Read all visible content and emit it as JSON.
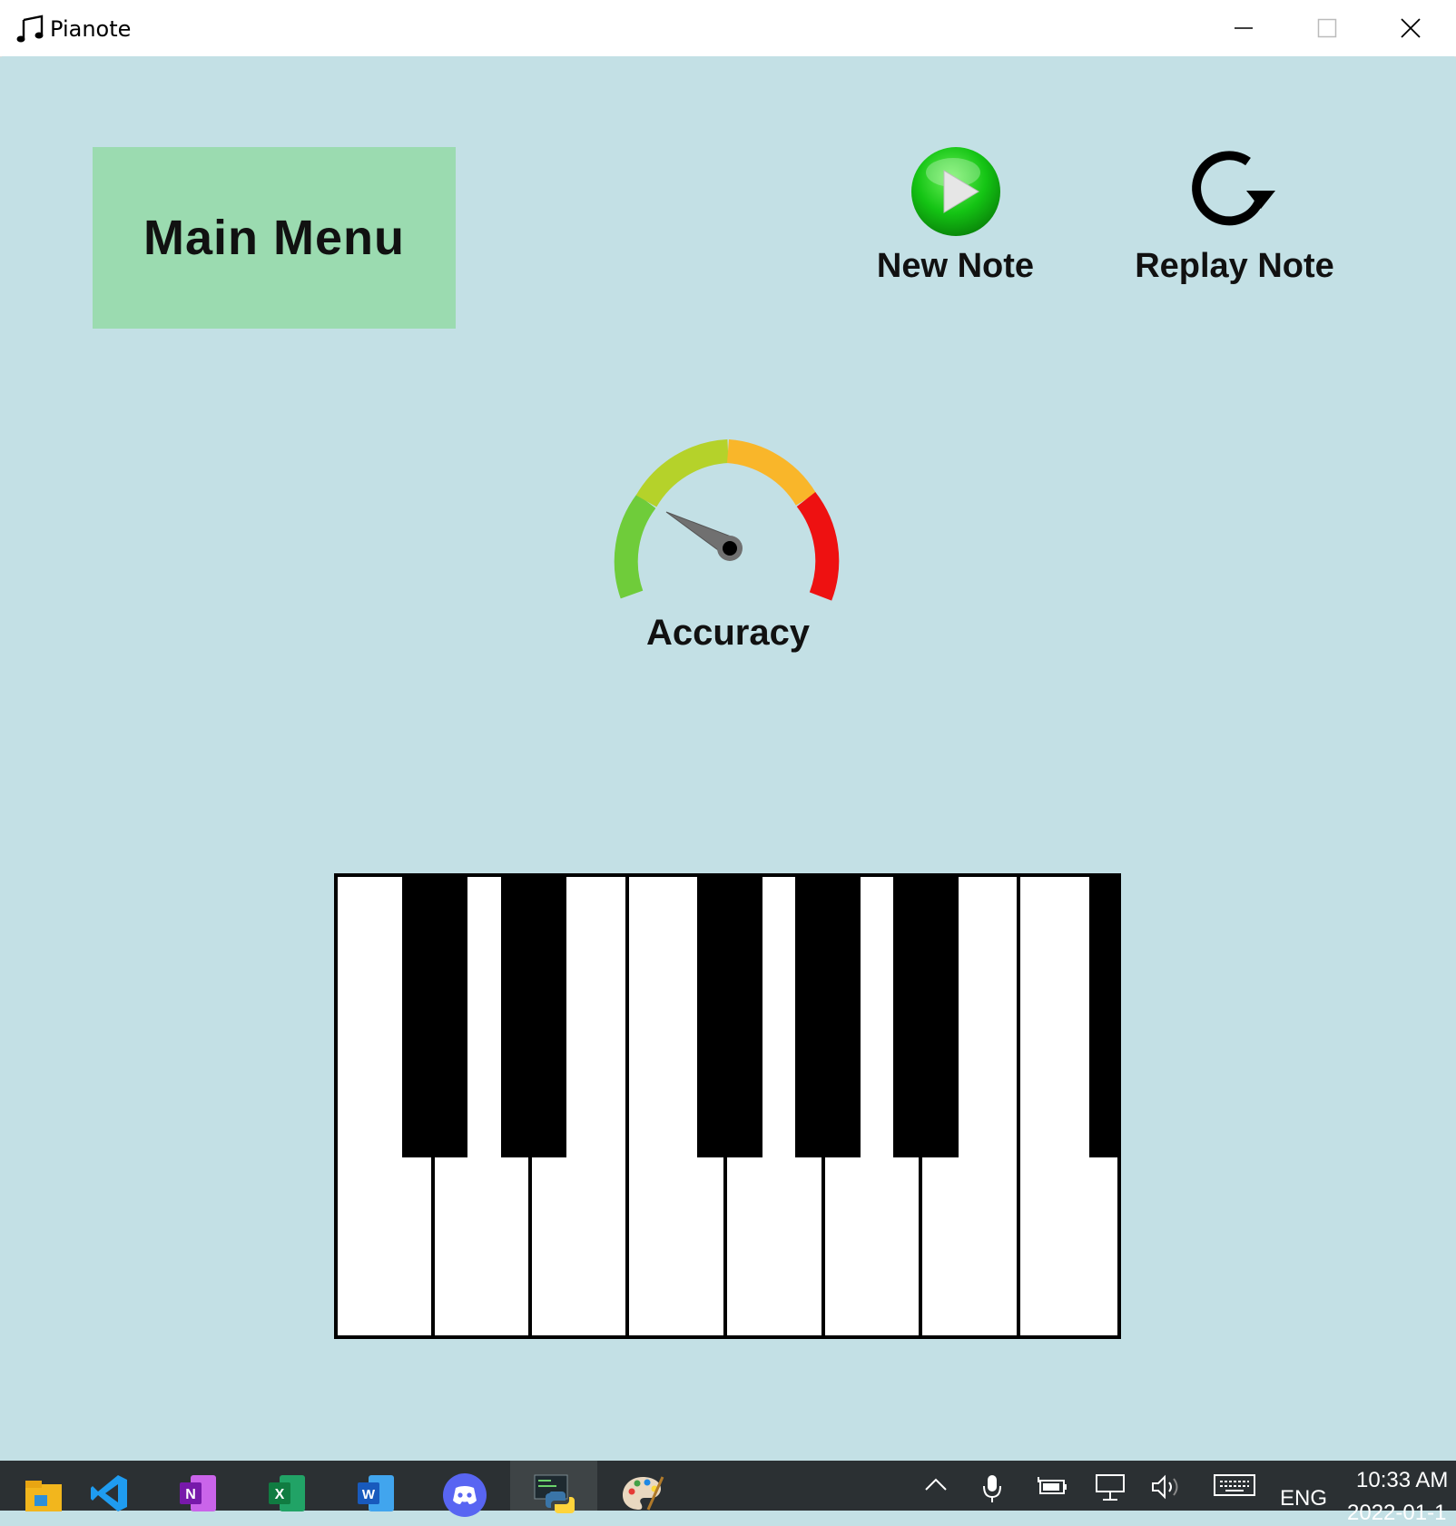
{
  "window": {
    "title": "Pianote"
  },
  "main_menu": {
    "label": "Main Menu"
  },
  "controls": {
    "new_note_label": "New Note",
    "replay_note_label": "Replay Note"
  },
  "gauge": {
    "label": "Accuracy",
    "segment_colors": [
      "#6fcc3a",
      "#b5d22a",
      "#f9b62a",
      "#ee1111"
    ],
    "needle_color": "#707070"
  },
  "piano": {
    "white_keys": 8,
    "black_keys": 6,
    "colors": {
      "white": "#ffffff",
      "black": "#000000"
    }
  },
  "taskbar": {
    "apps": [
      "file-explorer-icon",
      "vscode-icon",
      "onenote-icon",
      "excel-icon",
      "word-icon",
      "discord-icon",
      "python-icon",
      "paint-icon"
    ],
    "language": "ENG",
    "time": "10:33 AM",
    "date": "2022-01-1"
  },
  "colors": {
    "background": "#c3e0e5",
    "main_menu_bg": "#9bdbb0",
    "play_green": "#11c411",
    "taskbar": "#2b3033"
  }
}
